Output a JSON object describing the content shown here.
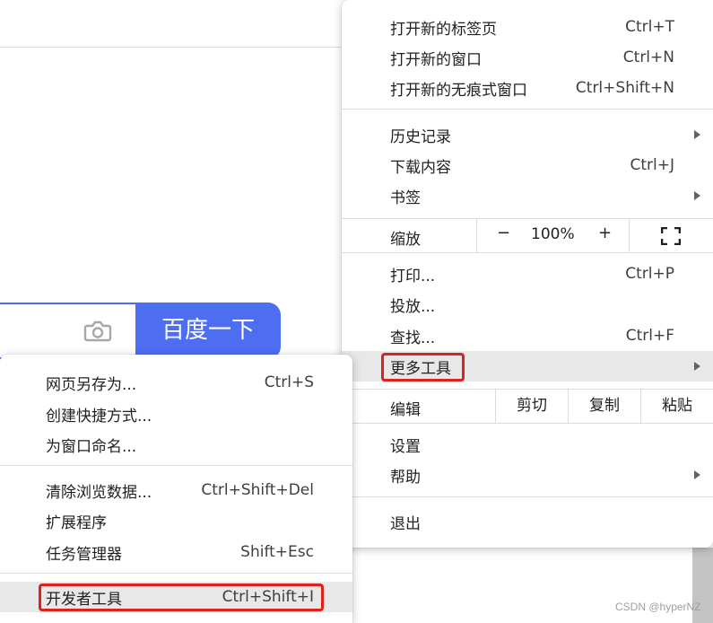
{
  "background": {
    "search_button_label": "百度一下",
    "watermark": "CSDN @hyperNZ"
  },
  "main_menu": {
    "new_tab": {
      "label": "打开新的标签页",
      "shortcut": "Ctrl+T"
    },
    "new_window": {
      "label": "打开新的窗口",
      "shortcut": "Ctrl+N"
    },
    "new_incognito": {
      "label": "打开新的无痕式窗口",
      "shortcut": "Ctrl+Shift+N"
    },
    "history": {
      "label": "历史记录"
    },
    "downloads": {
      "label": "下载内容",
      "shortcut": "Ctrl+J"
    },
    "bookmarks": {
      "label": "书签"
    },
    "zoom": {
      "label": "缩放",
      "minus": "−",
      "value": "100%",
      "plus": "+"
    },
    "print": {
      "label": "打印...",
      "shortcut": "Ctrl+P"
    },
    "cast": {
      "label": "投放..."
    },
    "find": {
      "label": "查找...",
      "shortcut": "Ctrl+F"
    },
    "more_tools": {
      "label": "更多工具"
    },
    "edit": {
      "label": "编辑",
      "cut": "剪切",
      "copy": "复制",
      "paste": "粘贴"
    },
    "settings": {
      "label": "设置"
    },
    "help": {
      "label": "帮助"
    },
    "exit": {
      "label": "退出"
    }
  },
  "sub_menu": {
    "save_page": {
      "label": "网页另存为...",
      "shortcut": "Ctrl+S"
    },
    "create_shortcut": {
      "label": "创建快捷方式..."
    },
    "name_window": {
      "label": "为窗口命名..."
    },
    "clear_data": {
      "label": "清除浏览数据...",
      "shortcut": "Ctrl+Shift+Del"
    },
    "extensions": {
      "label": "扩展程序"
    },
    "task_manager": {
      "label": "任务管理器",
      "shortcut": "Shift+Esc"
    },
    "dev_tools": {
      "label": "开发者工具",
      "shortcut": "Ctrl+Shift+I"
    }
  },
  "colors": {
    "accent_blue": "#4e6ef2",
    "highlight_red": "#e0201b",
    "hover_bg": "#e8e8e8"
  }
}
